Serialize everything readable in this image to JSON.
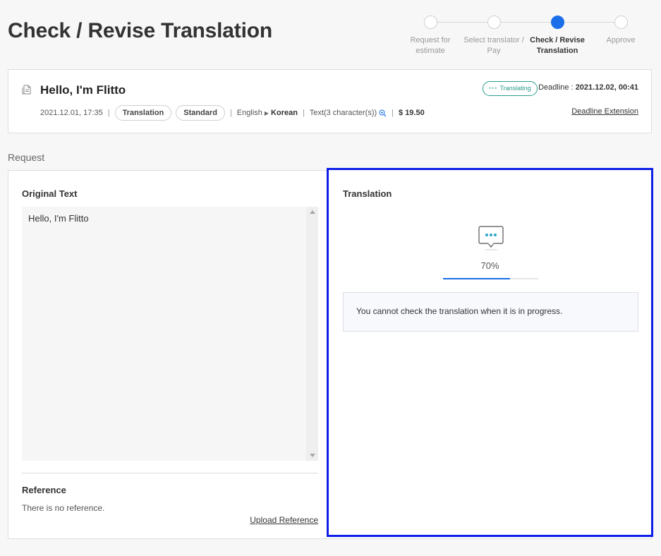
{
  "page": {
    "title": "Check / Revise Translation"
  },
  "stepper": {
    "steps": [
      {
        "label_line1": "Request for",
        "label_line2": "estimate",
        "active": false
      },
      {
        "label_line1": "Select translator /",
        "label_line2": "Pay",
        "active": false
      },
      {
        "label_line1": "Check / Revise",
        "label_line2": "Translation",
        "active": true
      },
      {
        "label_line1": "Approve",
        "label_line2": "",
        "active": false
      }
    ]
  },
  "request": {
    "icon": "document-icon",
    "title": "Hello, I'm Flitto",
    "date": "2021.12.01, 17:35",
    "type": "Translation",
    "grade": "Standard",
    "source_lang": "English",
    "target_lang": "Korean",
    "content_type": "Text(3 character(s))",
    "price": "$ 19.50",
    "status": "Translating",
    "deadline_label": "Deadline : ",
    "deadline_value": "2021.12.02, 00:41",
    "deadline_extension": "Deadline Extension"
  },
  "section": {
    "request_label": "Request"
  },
  "original": {
    "heading": "Original Text",
    "text": "Hello, I'm Flitto"
  },
  "reference": {
    "heading": "Reference",
    "empty_text": "There is no reference.",
    "upload_link": "Upload Reference"
  },
  "translation": {
    "heading": "Translation",
    "icon": "chat-bubble-icon",
    "progress_label": "70%",
    "progress_value": 0.7,
    "notice": "You cannot check the translation when it is in progress."
  },
  "colors": {
    "accent": "#1a6ee8",
    "status": "#2a9d8f",
    "highlight_border": "#0d1ee8"
  }
}
